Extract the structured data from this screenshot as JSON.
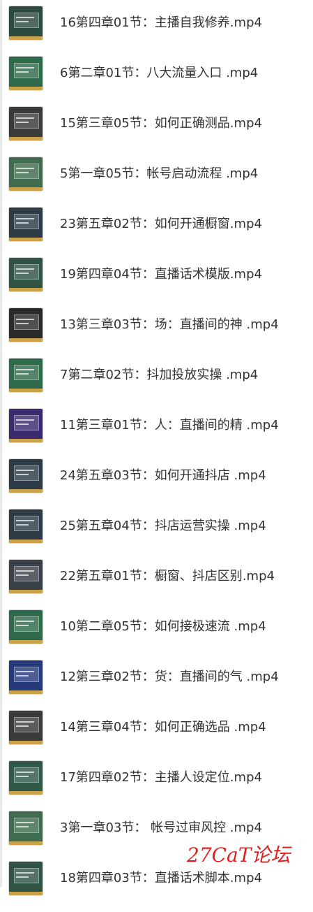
{
  "files": [
    {
      "name": "16第四章01节：主播自我修养.mp4",
      "thumb_color": "#2d4a3e"
    },
    {
      "name": "6第二章01节：八大流量入口 .mp4",
      "thumb_color": "#2f6a4c"
    },
    {
      "name": "15第三章05节：如何正确测品.mp4",
      "thumb_color": "#3a3a3a"
    },
    {
      "name": "5第一章05节：帐号启动流程 .mp4",
      "thumb_color": "#3f6b4e"
    },
    {
      "name": "23第五章02节：如何开通橱窗.mp4",
      "thumb_color": "#2c3b46"
    },
    {
      "name": "19第四章04节：直播话术模版.mp4",
      "thumb_color": "#2f5446"
    },
    {
      "name": "13第三章03节：场：直播间的神 .mp4",
      "thumb_color": "#2a2a2a"
    },
    {
      "name": "7第二章02节：抖加投放实操 .mp4",
      "thumb_color": "#2f6a4c"
    },
    {
      "name": "11第三章01节：人：直播间的精 .mp4",
      "thumb_color": "#3b2a6e"
    },
    {
      "name": "24第五章03节：如何开通抖店 .mp4",
      "thumb_color": "#2c3b46"
    },
    {
      "name": "25第五章04节：抖店运营实操 .mp4",
      "thumb_color": "#2c3b46"
    },
    {
      "name": "22第五章01节：橱窗、抖店区别.mp4",
      "thumb_color": "#3a4048"
    },
    {
      "name": "10第二章05节：如何接极速流 .mp4",
      "thumb_color": "#2f6a4c"
    },
    {
      "name": "12第三章02节：货：直播间的气 .mp4",
      "thumb_color": "#243a7a"
    },
    {
      "name": "14第三章04节：如何正确选品 .mp4",
      "thumb_color": "#3a3a3a"
    },
    {
      "name": "17第四章02节：主播人设定位.mp4",
      "thumb_color": "#2f5a48"
    },
    {
      "name": "3第一章03节： 帐号过审风控 .mp4",
      "thumb_color": "#3f6b4e"
    },
    {
      "name": "18第四章03节：直播话术脚本.mp4",
      "thumb_color": "#2f5446"
    }
  ],
  "watermark": "27CaT论坛"
}
